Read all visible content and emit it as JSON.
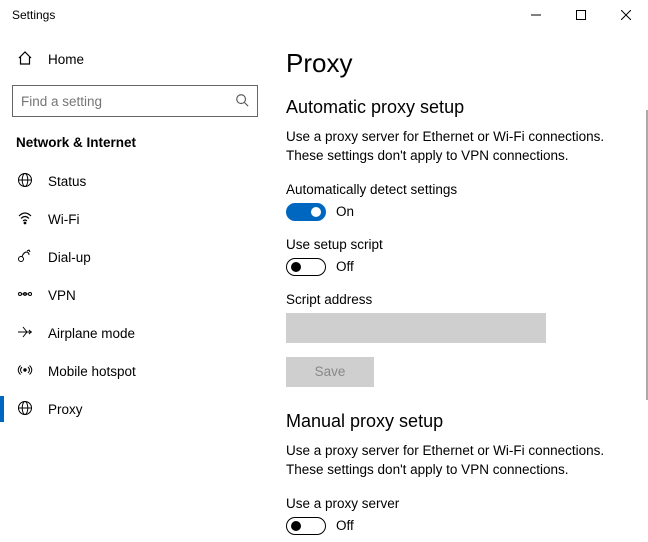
{
  "window": {
    "title": "Settings"
  },
  "sidebar": {
    "home_label": "Home",
    "search_placeholder": "Find a setting",
    "section_label": "Network & Internet",
    "items": [
      {
        "label": "Status",
        "icon": "status"
      },
      {
        "label": "Wi-Fi",
        "icon": "wifi"
      },
      {
        "label": "Dial-up",
        "icon": "dialup"
      },
      {
        "label": "VPN",
        "icon": "vpn"
      },
      {
        "label": "Airplane mode",
        "icon": "airplane"
      },
      {
        "label": "Mobile hotspot",
        "icon": "hotspot"
      },
      {
        "label": "Proxy",
        "icon": "proxy"
      }
    ],
    "active_index": 6
  },
  "main": {
    "title": "Proxy",
    "sections": {
      "auto": {
        "heading": "Automatic proxy setup",
        "description": "Use a proxy server for Ethernet or Wi-Fi connections. These settings don't apply to VPN connections.",
        "detect_label": "Automatically detect settings",
        "detect_state_label": "On",
        "script_label": "Use setup script",
        "script_state_label": "Off",
        "address_label": "Script address",
        "address_value": "",
        "save_label": "Save"
      },
      "manual": {
        "heading": "Manual proxy setup",
        "description": "Use a proxy server for Ethernet or Wi-Fi connections. These settings don't apply to VPN connections.",
        "use_label": "Use a proxy server",
        "use_state_label": "Off"
      }
    }
  }
}
